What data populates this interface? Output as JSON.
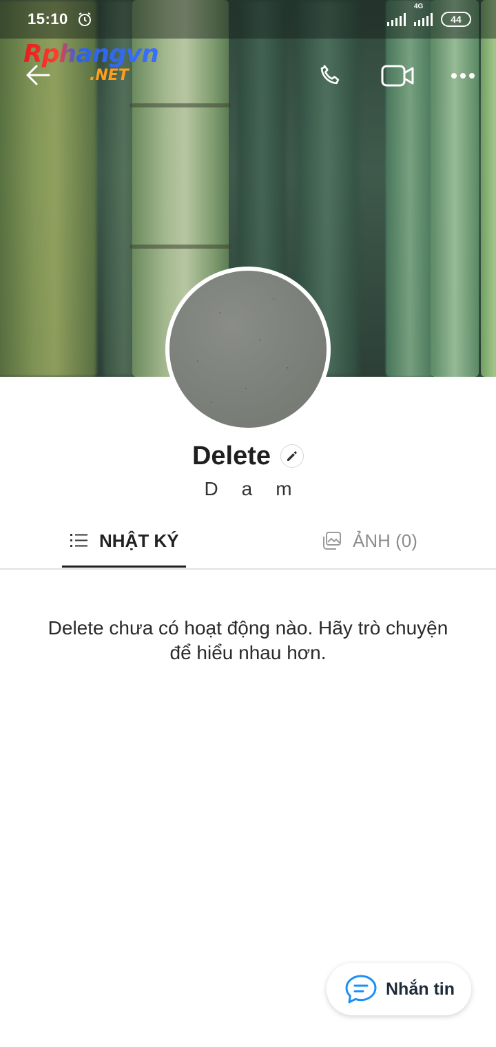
{
  "status_bar": {
    "time": "15:10",
    "network_label": "4G",
    "battery": "44",
    "icons": [
      "alarm-icon",
      "signal-icon",
      "signal-4g-icon",
      "battery-icon"
    ]
  },
  "toolbar": {
    "logo_line1": "Rphangvn",
    "logo_line2": ".NET",
    "icons": [
      "back-arrow-icon",
      "phone-icon",
      "video-call-icon",
      "more-options-icon"
    ]
  },
  "profile": {
    "name": "Delete",
    "subname": "Dam"
  },
  "tabs": [
    {
      "label": "NHẬT KÝ",
      "icon": "list-icon",
      "active": true
    },
    {
      "label": "ẢNH (0)",
      "icon": "photos-icon",
      "active": false
    }
  ],
  "empty_message": "Delete chưa có hoạt động nào. Hãy trò chuyện để hiểu nhau hơn.",
  "fab": {
    "label": "Nhắn tin",
    "icon": "chat-bubble-icon"
  },
  "colors": {
    "accent": "#1c8ff5",
    "text_dark": "#1f1f1f",
    "text_muted": "#8c8c8c",
    "cover_dark": "#31473d"
  }
}
